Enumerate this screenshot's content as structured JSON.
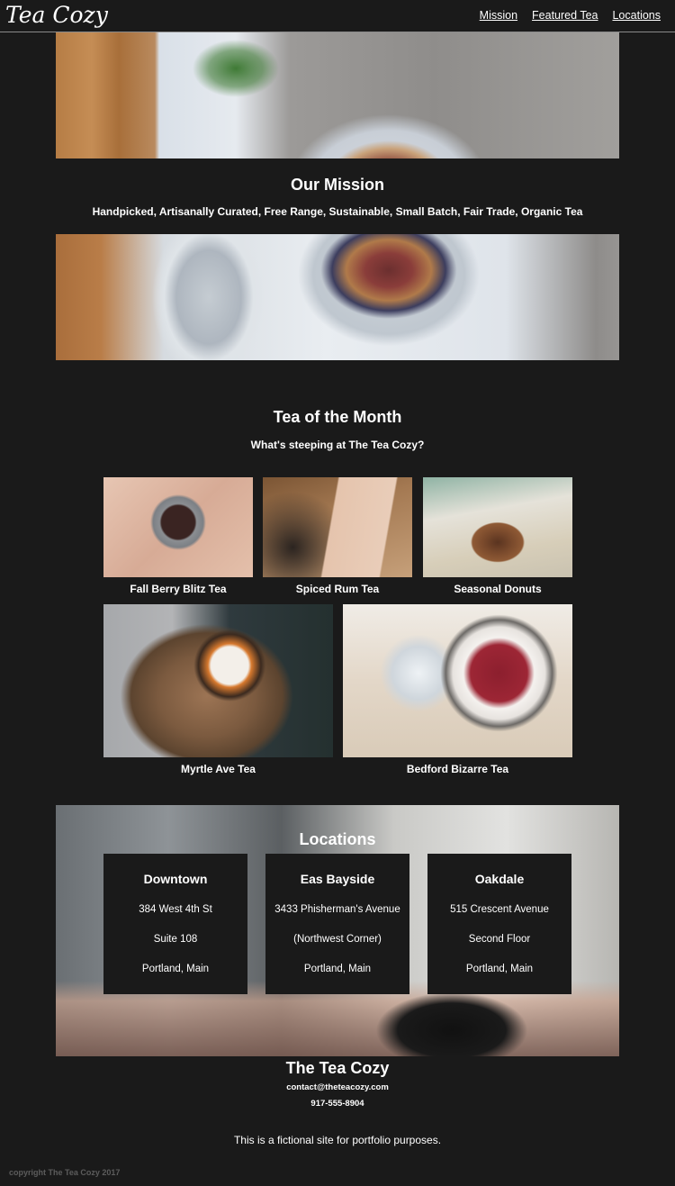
{
  "header": {
    "logo": "Tea Cozy",
    "nav": [
      {
        "label": "Mission"
      },
      {
        "label": "Featured Tea"
      },
      {
        "label": "Locations"
      }
    ]
  },
  "mission": {
    "title": "Our Mission",
    "tagline": "Handpicked, Artisanally Curated, Free Range, Sustainable, Small Batch, Fair Trade, Organic Tea"
  },
  "featured": {
    "title": "Tea of the Month",
    "subtitle": "What's steeping at The Tea Cozy?",
    "teas": [
      {
        "name": "Fall Berry Blitz Tea"
      },
      {
        "name": "Spiced Rum Tea"
      },
      {
        "name": "Seasonal Donuts"
      },
      {
        "name": "Myrtle Ave Tea"
      },
      {
        "name": "Bedford Bizarre Tea"
      }
    ]
  },
  "locations": {
    "title": "Locations",
    "stores": [
      {
        "name": "Downtown",
        "line1": "384 West 4th St",
        "line2": "Suite 108",
        "line3": "Portland, Main"
      },
      {
        "name": "Eas Bayside",
        "line1": "3433 Phisherman's Avenue",
        "line2": "(Northwest Corner)",
        "line3": "Portland, Main"
      },
      {
        "name": "Oakdale",
        "line1": "515 Crescent Avenue",
        "line2": "Second Floor",
        "line3": "Portland, Main"
      }
    ]
  },
  "footer": {
    "title": "The Tea Cozy",
    "email": "contact@theteacozy.com",
    "phone": "917-555-8904",
    "note": "This is a fictional site for portfolio purposes.",
    "copyright": "copyright The Tea Cozy 2017"
  }
}
